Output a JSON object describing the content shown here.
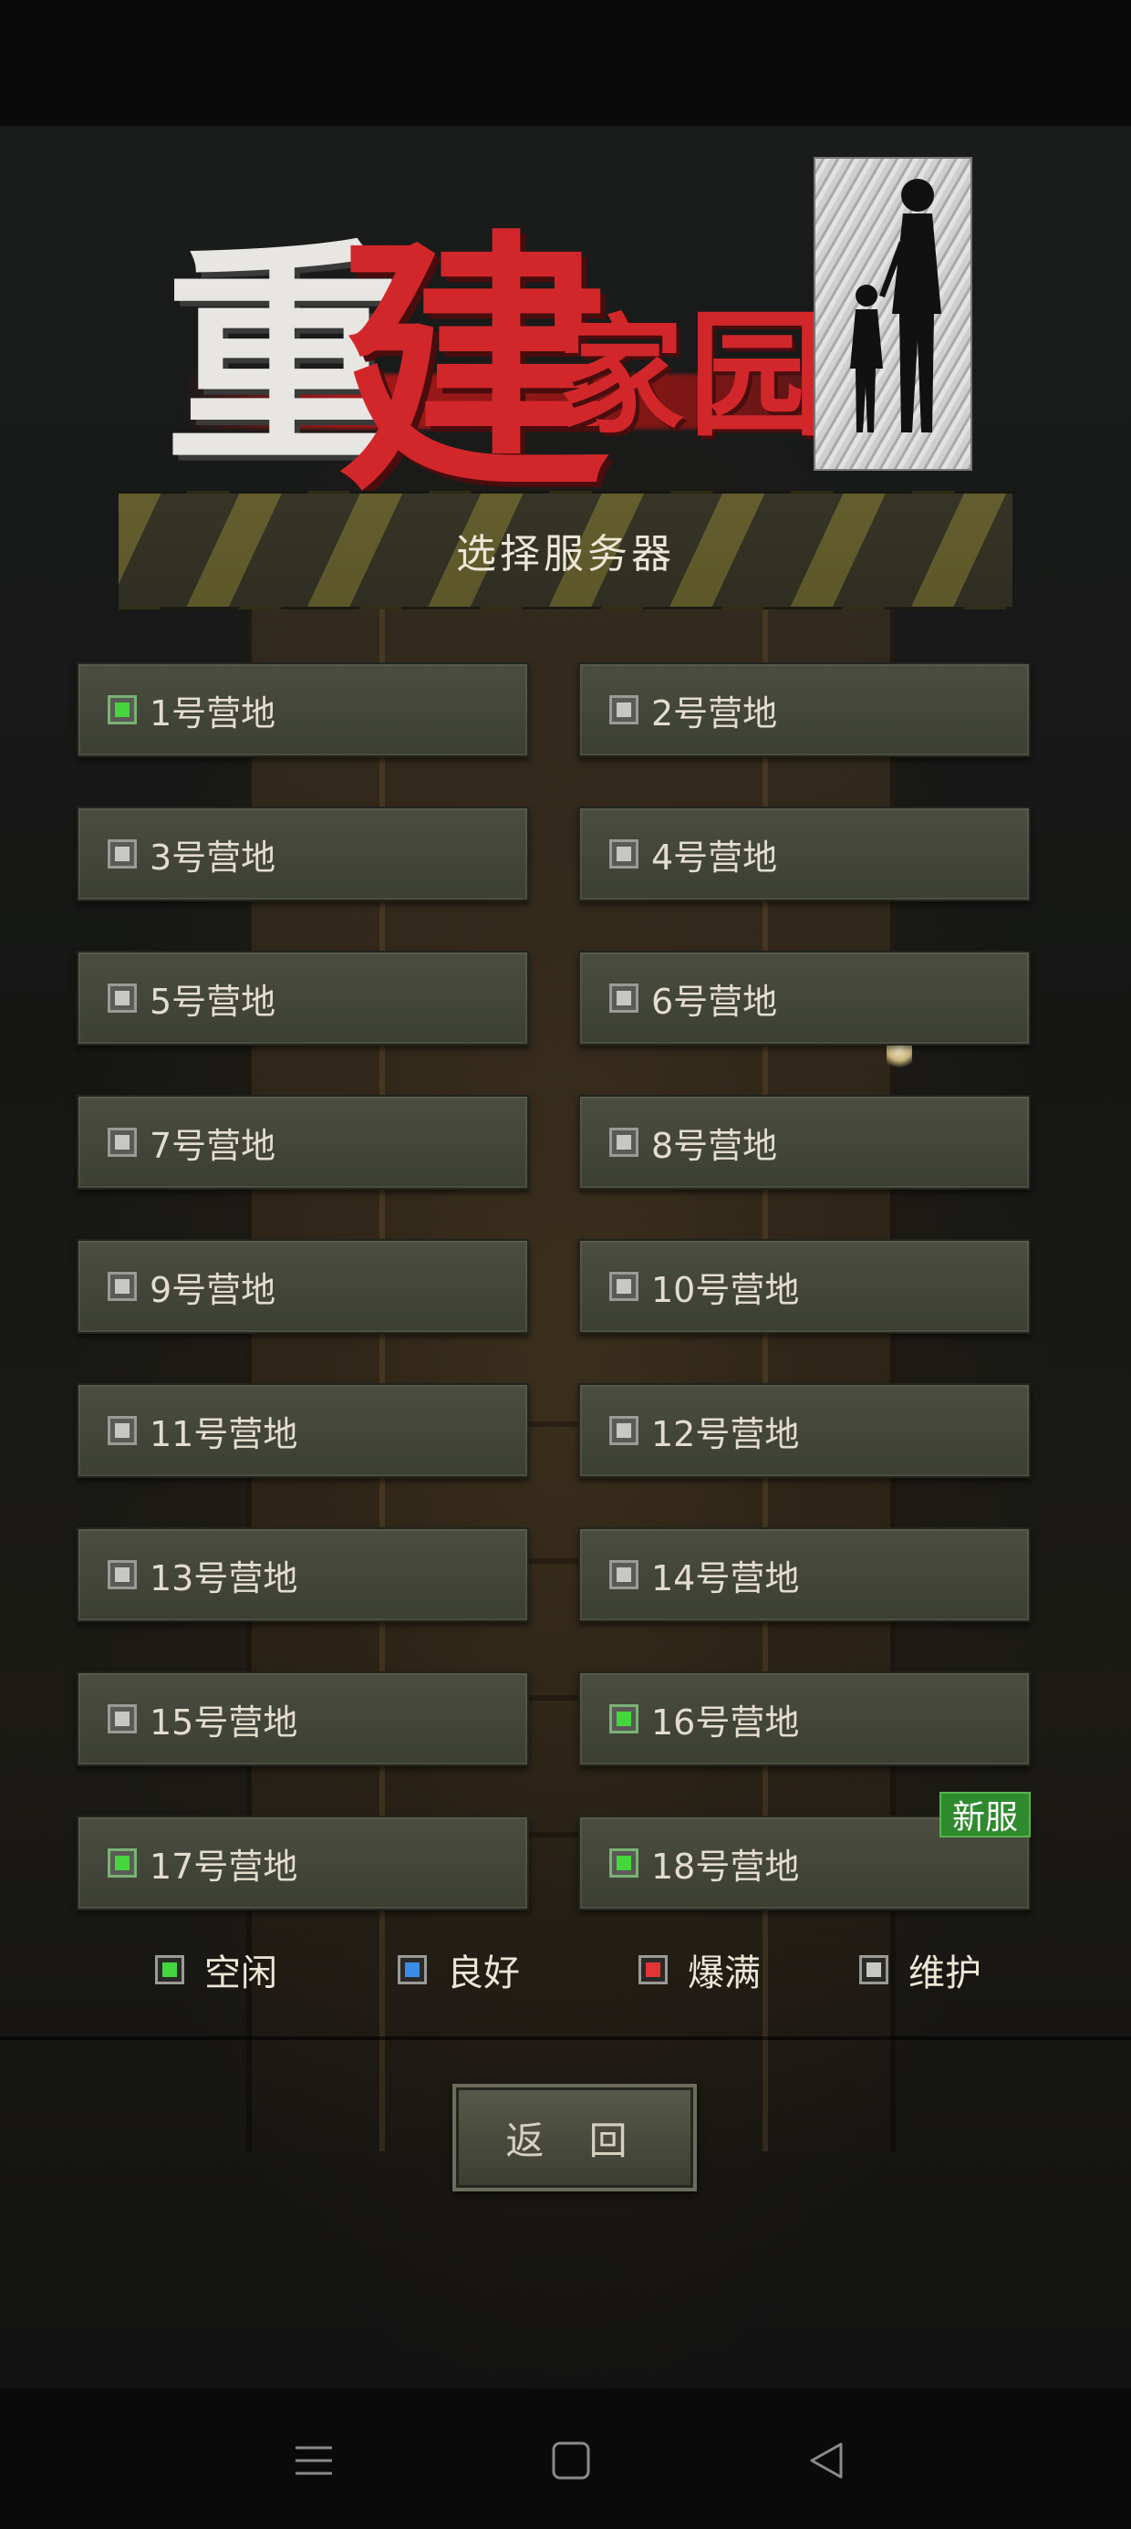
{
  "app": {
    "logo_chars": [
      "重",
      "建",
      "家",
      "园"
    ]
  },
  "header": {
    "title": "选择服务器"
  },
  "servers": [
    {
      "label": "1号营地",
      "status": "green"
    },
    {
      "label": "2号营地",
      "status": "gray"
    },
    {
      "label": "3号营地",
      "status": "gray"
    },
    {
      "label": "4号营地",
      "status": "gray"
    },
    {
      "label": "5号营地",
      "status": "gray"
    },
    {
      "label": "6号营地",
      "status": "gray"
    },
    {
      "label": "7号营地",
      "status": "gray"
    },
    {
      "label": "8号营地",
      "status": "gray"
    },
    {
      "label": "9号营地",
      "status": "gray"
    },
    {
      "label": "10号营地",
      "status": "gray"
    },
    {
      "label": "11号营地",
      "status": "gray"
    },
    {
      "label": "12号营地",
      "status": "gray"
    },
    {
      "label": "13号营地",
      "status": "gray"
    },
    {
      "label": "14号营地",
      "status": "gray"
    },
    {
      "label": "15号营地",
      "status": "gray"
    },
    {
      "label": "16号营地",
      "status": "green"
    },
    {
      "label": "17号营地",
      "status": "green"
    },
    {
      "label": "18号营地",
      "status": "green",
      "badge": "新服"
    }
  ],
  "legend": [
    {
      "label": "空闲",
      "color": "green"
    },
    {
      "label": "良好",
      "color": "blue"
    },
    {
      "label": "爆满",
      "color": "red"
    },
    {
      "label": "维护",
      "color": "gray"
    }
  ],
  "footer": {
    "back_label": "返 回"
  },
  "colors": {
    "idle": "#45d63d",
    "good": "#3a8ee8",
    "full": "#e23535",
    "maintenance": "#c7c7c3",
    "badge": "#2f8a2e"
  },
  "nav": {
    "icons": [
      "menu-icon",
      "home-icon",
      "back-icon"
    ]
  }
}
